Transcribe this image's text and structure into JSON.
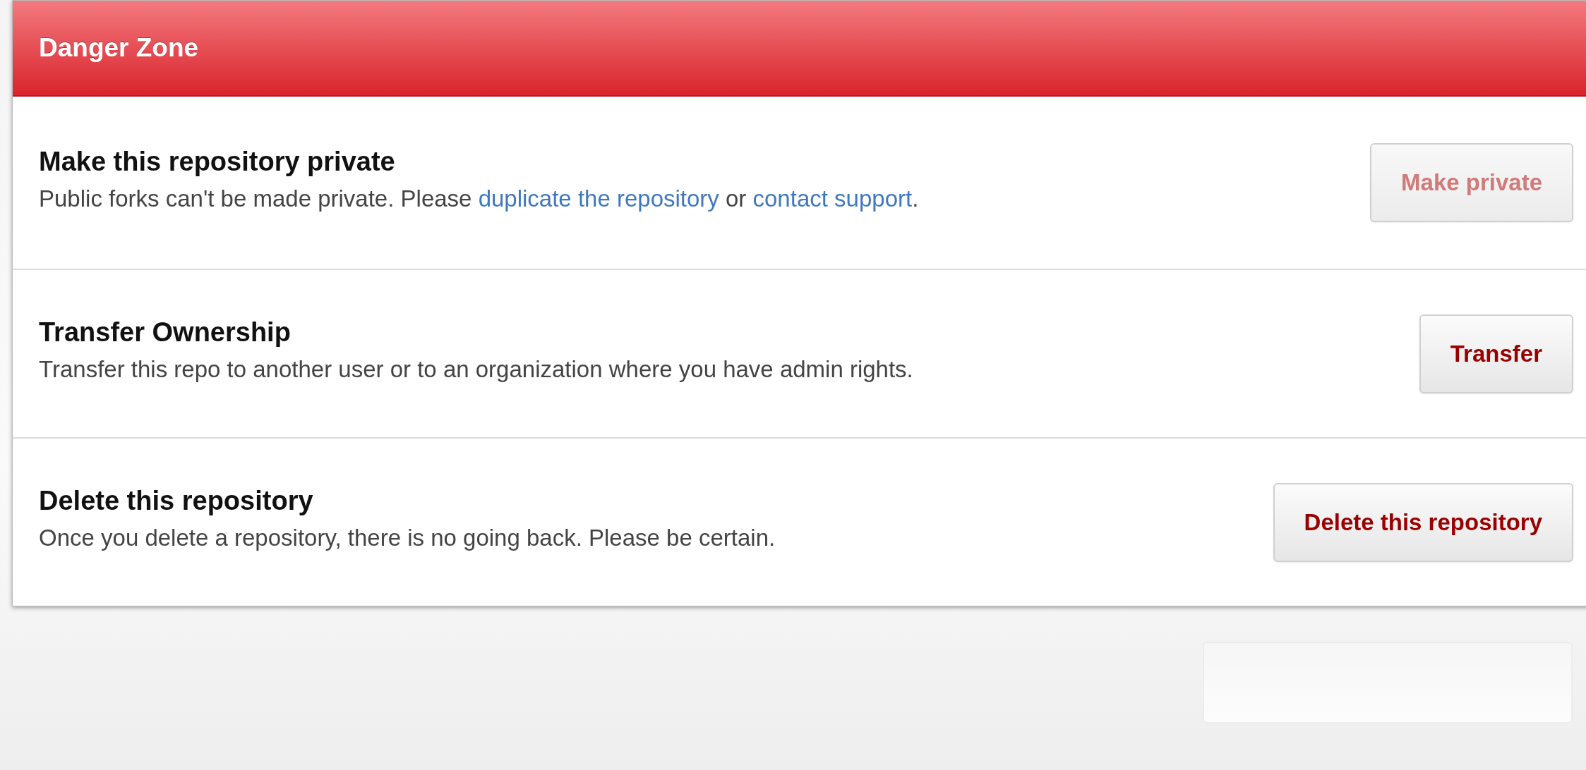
{
  "panel": {
    "title": "Danger Zone",
    "rows": [
      {
        "title": "Make this repository private",
        "description": [
          {
            "kind": "text",
            "text": "Public forks can't be made private. Please "
          },
          {
            "kind": "link",
            "text": "duplicate the repository"
          },
          {
            "kind": "text",
            "text": " or "
          },
          {
            "kind": "link",
            "text": "contact support"
          },
          {
            "kind": "text",
            "text": "."
          }
        ],
        "button": {
          "label": "Make private",
          "disabled": true
        }
      },
      {
        "title": "Transfer Ownership",
        "description": [
          {
            "kind": "text",
            "text": "Transfer this repo to another user or to an organization where you have admin rights."
          }
        ],
        "button": {
          "label": "Transfer",
          "disabled": false
        }
      },
      {
        "title": "Delete this repository",
        "description": [
          {
            "kind": "text",
            "text": "Once you delete a repository, there is no going back. Please be certain."
          }
        ],
        "button": {
          "label": "Delete this repository",
          "disabled": false
        }
      }
    ]
  }
}
